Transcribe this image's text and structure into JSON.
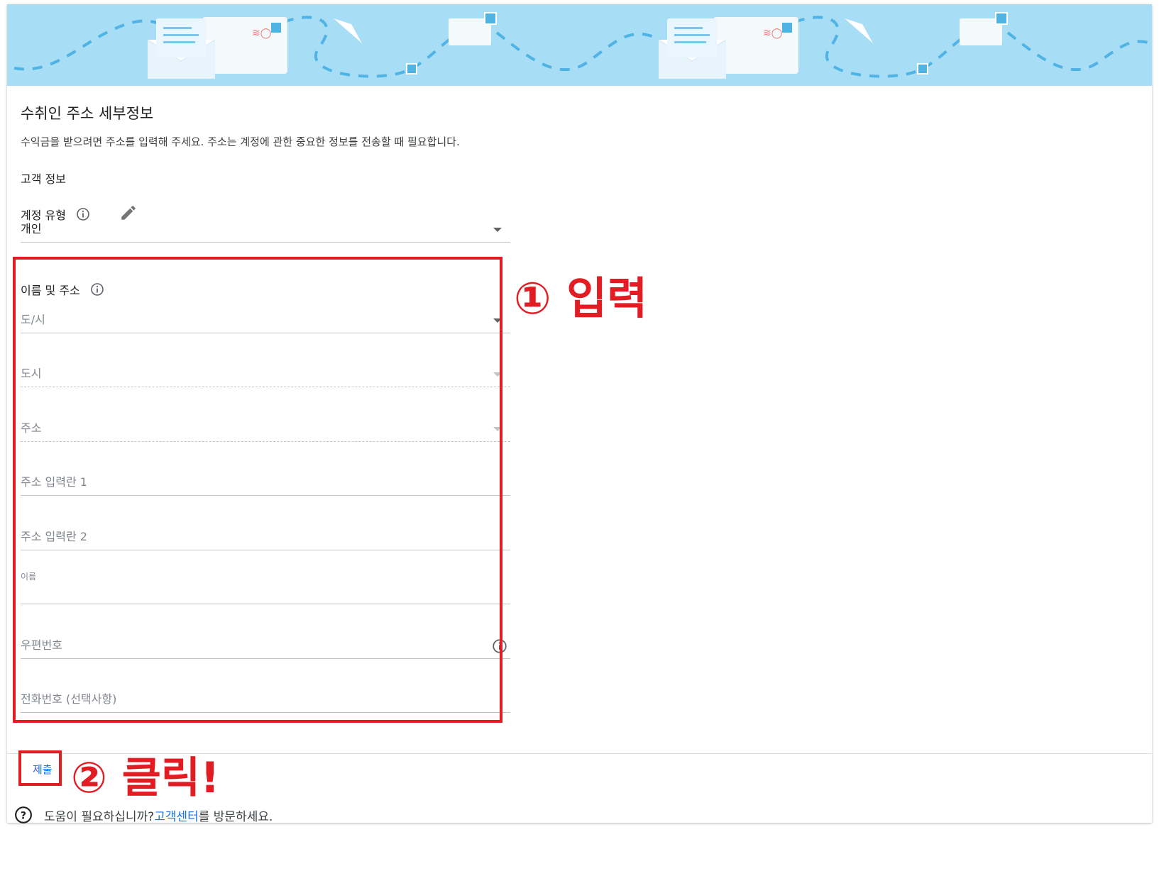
{
  "form": {
    "title": "수취인 주소 세부정보",
    "subtitle": "수익금을 받으려면 주소를 입력해 주세요. 주소는 계정에 관한 중요한 정보를 전송할 때 필요합니다.",
    "section_title": "고객 정보",
    "account_type_label": "계정 유형",
    "account_type_value": "개인",
    "name_address_label": "이름 및 주소",
    "fields": {
      "province": "도/시",
      "city": "도시",
      "address": "주소",
      "address_line1": "주소 입력란 1",
      "address_line2": "주소 입력란 2",
      "name_label": "이름",
      "postal_code": "우편번호",
      "phone": "전화번호 (선택사항)"
    },
    "submit_label": "제출"
  },
  "annotations": {
    "step1": "① 입력",
    "step2": "② 클릭!"
  },
  "help": {
    "prefix": "도움이 필요하십니까? ",
    "link": "고객센터",
    "suffix": "를 방문하세요."
  },
  "colors": {
    "accent": "#1a73e8",
    "annotation_red": "#e21c23",
    "banner": "#a8ddf6"
  }
}
